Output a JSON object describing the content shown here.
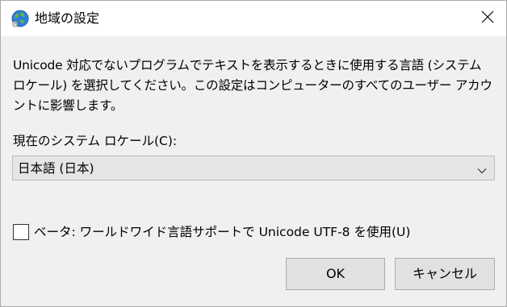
{
  "window": {
    "title": "地域の設定",
    "icon": "globe-icon",
    "close_icon": "close-icon"
  },
  "description": "Unicode 対応でないプログラムでテキストを表示するときに使用する言語 (システム ロケール) を選択してください。この設定はコンピューターのすべてのユーザー アカウントに影響します。",
  "locale": {
    "label": "現在のシステム ロケール(C):",
    "selected_value": "日本語 (日本)"
  },
  "utf8_option": {
    "label": "ベータ: ワールドワイド言語サポートで Unicode UTF-8 を使用(U)",
    "checked": false
  },
  "buttons": {
    "ok": "OK",
    "cancel": "キャンセル"
  },
  "colors": {
    "dialog_background": "#f0f0f0",
    "titlebar_background": "#ffffff",
    "button_background": "#e1e1e1",
    "select_background": "#e5e5e5"
  }
}
